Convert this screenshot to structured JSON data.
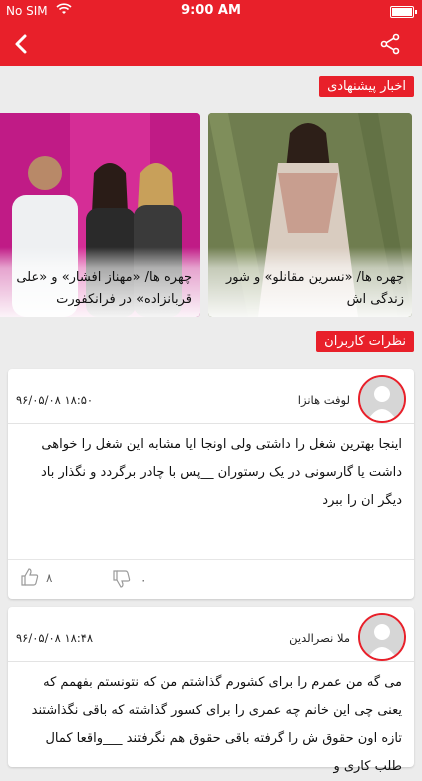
{
  "status_bar": {
    "carrier": "No SIM",
    "time": "9:00 AM"
  },
  "nav": {
    "back_icon": "chevron-left-icon",
    "share_icon": "share-icon"
  },
  "sections": {
    "suggested_news": "اخبار پیشنهادی",
    "user_comments": "نظرات کاربران"
  },
  "suggested_cards": [
    {
      "caption": "چهره ها/ «نسرین مقانلو» و شور زندگی اش"
    },
    {
      "caption": "چهره ها/ «مهناز افشار» و «علی قربانزاده» در فرانکفورت"
    }
  ],
  "comments": [
    {
      "author": "لوفت هانزا",
      "date": "۹۶/۰۵/۰۸ ۱۸:۵۰",
      "text": "اینجا بهترین شغل را داشتی ولی اونجا ایا مشابه این شغل را خواهی داشت یا گارسونی در یک رستوران __پس با چادر برگردد و نگذار باد دیگر ان را ببرد",
      "likes": "۸",
      "dislikes": "۰"
    },
    {
      "author": "ملا نصرالدین",
      "date": "۹۶/۰۵/۰۸ ۱۸:۴۸",
      "text": "می گه من عمرم را برای کشورم گذاشتم من که نتونستم بفهمم که یعنی چی این خانم چه عمری را برای کسور گذاشته که باقی نگذاشتند تازه اون حقوق ش را گرفته باقی حقوق هم نگرفتند ___واقعا کمال طلب کاری و"
    }
  ],
  "colors": {
    "brand_red": "#e8202a"
  }
}
